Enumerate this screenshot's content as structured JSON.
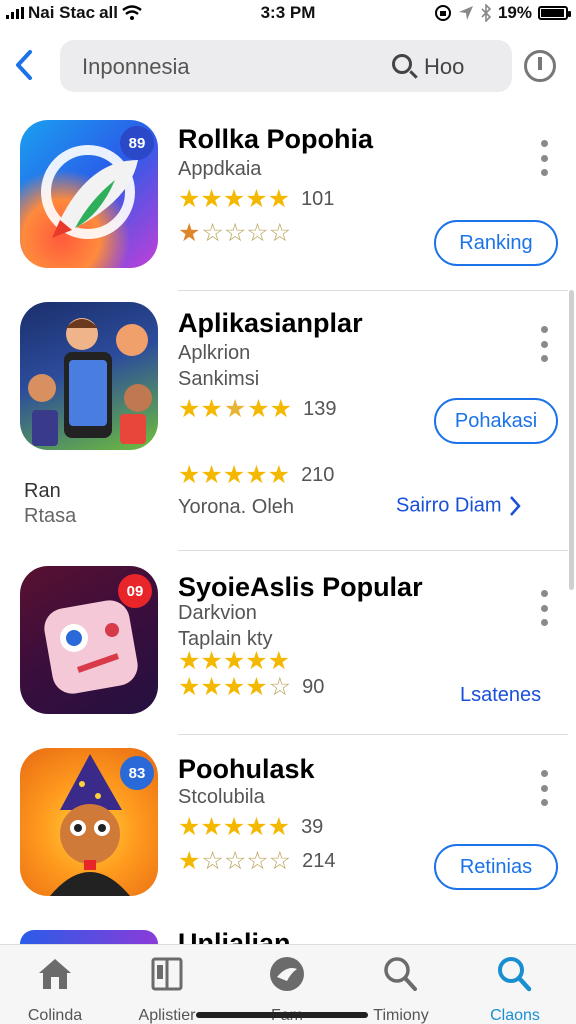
{
  "status_bar": {
    "carrier": "Nai Stac",
    "network": "all",
    "time": "3:3 PM",
    "battery": "19%"
  },
  "search": {
    "query": "Inponnesia",
    "scope_label": "Hoo"
  },
  "apps": [
    {
      "title": "Rollka Popohia",
      "subtitle": "Appdkaia",
      "badge": "89",
      "ratings": [
        {
          "stars": 5,
          "count": "101"
        },
        {
          "stars": 1,
          "count": ""
        }
      ],
      "action": "Ranking"
    },
    {
      "title": "Aplikasianplar",
      "subtitle": "Aplkrion",
      "subtitle2": "Sankimsi",
      "ratings": [
        {
          "stars": 5,
          "count": "139"
        },
        {
          "stars": 5,
          "count": "210"
        }
      ],
      "action": "Pohakasi",
      "left_label": "Ran",
      "left_sub": "Rtasa",
      "developer": "Yorona. Oleh",
      "link": "Sairro Diam"
    },
    {
      "title": "SyoieAslis Popular",
      "subtitle": "Darkvion",
      "subtitle2": "Taplain kty",
      "badge": "09",
      "ratings": [
        {
          "stars": 5,
          "count": ""
        },
        {
          "stars": 4,
          "count": "90"
        }
      ],
      "link": "Lsatenes"
    },
    {
      "title": "Poohulask",
      "subtitle": "Stcolubila",
      "badge": "83",
      "ratings": [
        {
          "stars": 5,
          "count": "39"
        },
        {
          "stars": 1,
          "count": "214"
        }
      ],
      "action": "Retinias"
    },
    {
      "title": "Unlialian"
    }
  ],
  "tabs": [
    {
      "label": "Colinda",
      "icon": "house-icon"
    },
    {
      "label": "Aplistier",
      "icon": "book-icon"
    },
    {
      "label": "Fam",
      "icon": "bird-icon"
    },
    {
      "label": "Timiony",
      "icon": "search-icon"
    },
    {
      "label": "Claons",
      "icon": "search-icon",
      "active": true
    }
  ],
  "colors": {
    "accent": "#1a73e8",
    "star": "#f5b800",
    "active_tab": "#1a8fd0"
  }
}
